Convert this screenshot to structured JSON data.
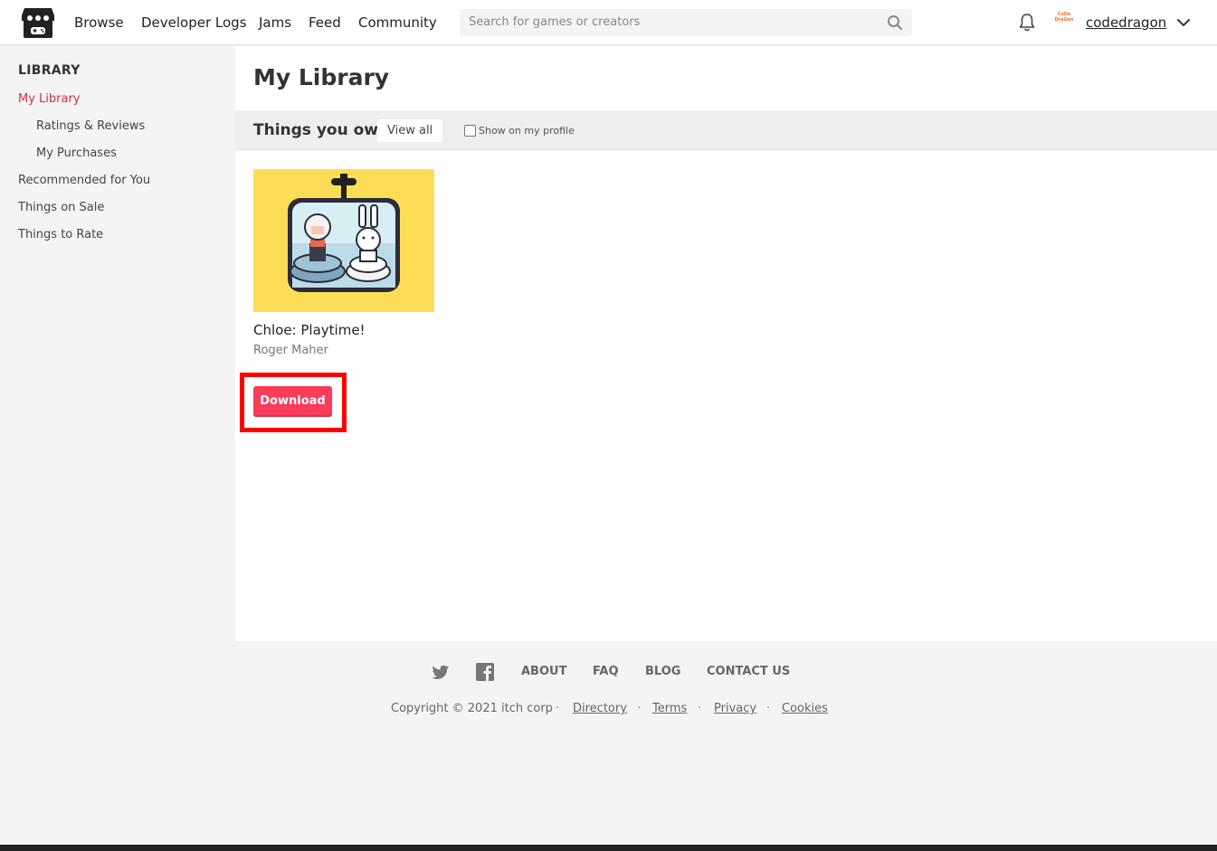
{
  "header": {
    "nav": [
      "Browse",
      "Developer Logs",
      "Jams",
      "Feed",
      "Community"
    ],
    "search_placeholder": "Search for games or creators",
    "avatar_text": "CoDe DraGon",
    "username": "codedragon"
  },
  "sidebar": {
    "heading": "LIBRARY",
    "items": [
      "My Library",
      "Ratings & Reviews",
      "My Purchases",
      "Recommended for You",
      "Things on Sale",
      "Things to Rate"
    ]
  },
  "main": {
    "title": "My Library",
    "section_title": "Things you own",
    "view_all": "View all",
    "show_on_profile": "Show on my profile",
    "game": {
      "title": "Chloe: Playtime!",
      "author": "Roger Maher",
      "download_label": "Download"
    }
  },
  "footer": {
    "links": [
      "ABOUT",
      "FAQ",
      "BLOG",
      "CONTACT US"
    ],
    "copyright": "Copyright © 2021 itch corp",
    "legal": [
      "Directory",
      "Terms",
      "Privacy",
      "Cookies"
    ]
  },
  "colors": {
    "accent": "#da2c49",
    "download": "#fa3b5a",
    "highlight": "#ff0000"
  }
}
